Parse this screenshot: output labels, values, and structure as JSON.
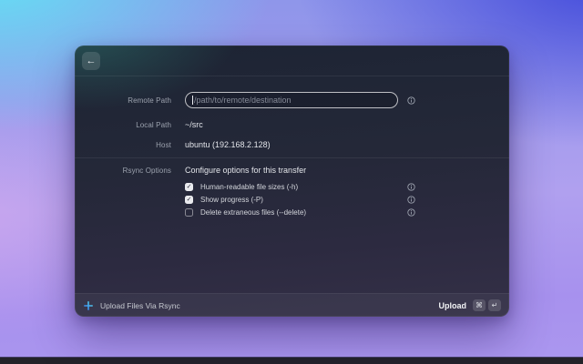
{
  "colors": {
    "wallpaper_cyan": "#62e4f5",
    "wallpaper_indigo": "#4048da",
    "wallpaper_lavender": "#ab9bee",
    "window_teal_glow": "#2c706a",
    "window_navy": "#1d2434",
    "window_purple": "#343047",
    "ext_icon_blue": "#2f6df0",
    "ext_icon_cyan": "#5ce6ee"
  },
  "window": {
    "back_button_glyph": "←",
    "form": {
      "remote_path": {
        "label": "Remote Path",
        "value": "",
        "placeholder": "/path/to/remote/destination"
      },
      "local_path": {
        "label": "Local Path",
        "value": "~/src"
      },
      "host": {
        "label": "Host",
        "value": "ubuntu (192.168.2.128)"
      },
      "rsync_options": {
        "label": "Rsync Options",
        "description": "Configure options for this transfer",
        "options": [
          {
            "label": "Human-readable file sizes (-h)",
            "checked": true,
            "check_glyph": "✓"
          },
          {
            "label": "Show progress (-P)",
            "checked": true,
            "check_glyph": "✓"
          },
          {
            "label": "Delete extraneous files (--delete)",
            "checked": false,
            "check_glyph": "✓"
          }
        ]
      }
    },
    "footer": {
      "title": "Upload Files Via Rsync",
      "action_label": "Upload",
      "shortcut_keys": [
        "⌘",
        "↵"
      ]
    }
  }
}
